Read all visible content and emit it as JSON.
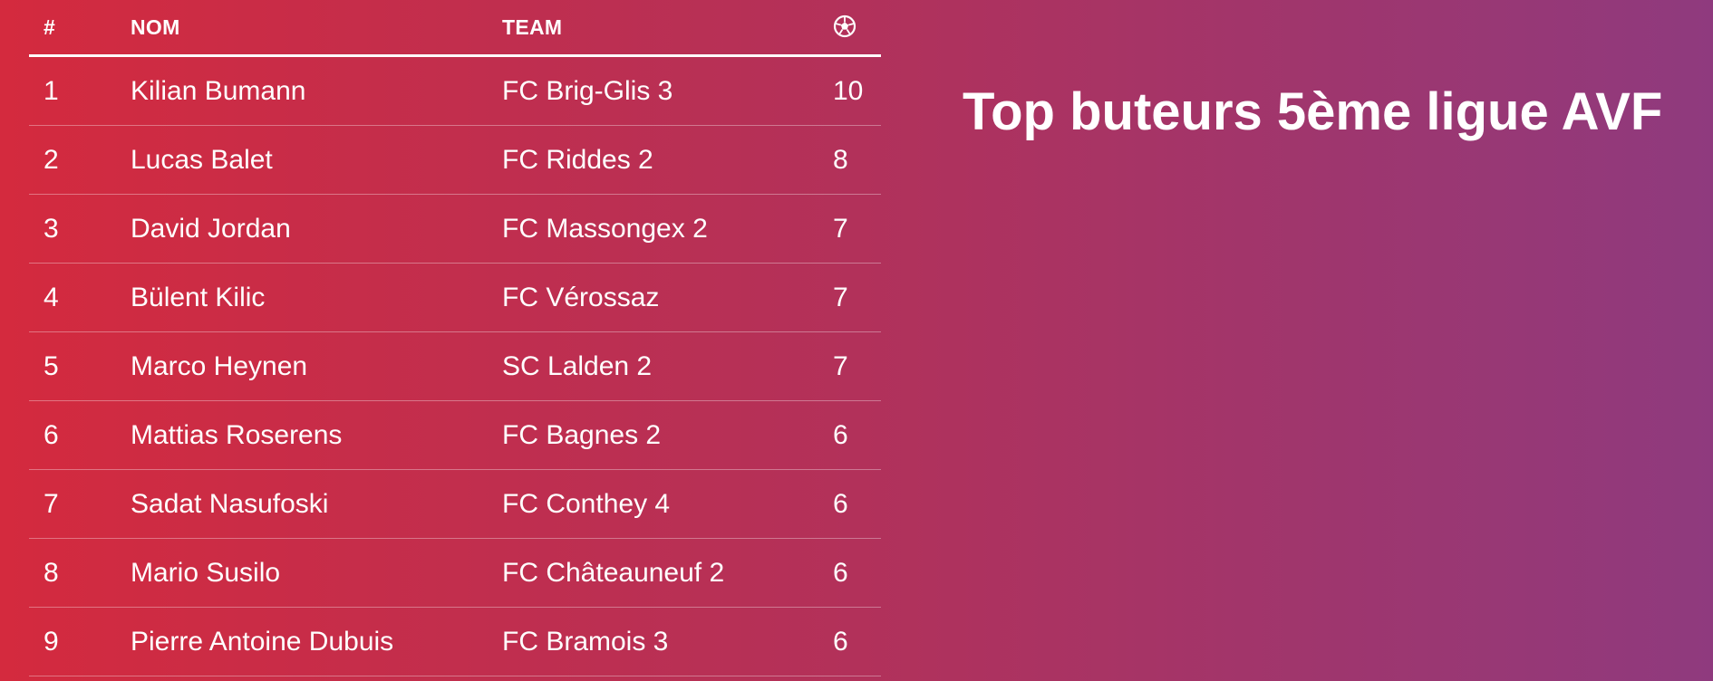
{
  "title": "Top buteurs 5ème ligue AVF",
  "table": {
    "headers": {
      "rank": "#",
      "name": "NOM",
      "team": "TEAM",
      "goals_icon": "soccer-ball-icon"
    },
    "rows": [
      {
        "rank": "1",
        "name": "Kilian Bumann",
        "team": "FC Brig-Glis 3",
        "goals": "10"
      },
      {
        "rank": "2",
        "name": "Lucas Balet",
        "team": "FC Riddes 2",
        "goals": "8"
      },
      {
        "rank": "3",
        "name": "David Jordan",
        "team": "FC Massongex 2",
        "goals": "7"
      },
      {
        "rank": "4",
        "name": "Bülent Kilic",
        "team": "FC Vérossaz",
        "goals": "7"
      },
      {
        "rank": "5",
        "name": "Marco Heynen",
        "team": "SC Lalden 2",
        "goals": "7"
      },
      {
        "rank": "6",
        "name": "Mattias Roserens",
        "team": "FC Bagnes 2",
        "goals": "6"
      },
      {
        "rank": "7",
        "name": "Sadat Nasufoski",
        "team": "FC Conthey 4",
        "goals": "6"
      },
      {
        "rank": "8",
        "name": "Mario Susilo",
        "team": "FC Châteauneuf 2",
        "goals": "6"
      },
      {
        "rank": "9",
        "name": "Pierre Antoine Dubuis",
        "team": "FC Bramois 3",
        "goals": "6"
      }
    ]
  },
  "colors": {
    "gradient_start": "#d42a3e",
    "gradient_end": "#8f3a7e",
    "text": "#ffffff"
  }
}
